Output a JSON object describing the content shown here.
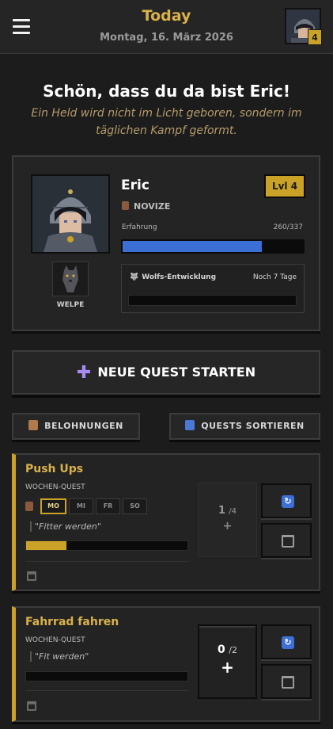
{
  "header": {
    "title": "Today",
    "date": "Montag, 16. März 2026",
    "avatar_level": "4"
  },
  "welcome": {
    "heading": "Schön, dass du da bist Eric!",
    "tagline": "Ein Held wird nicht im Licht geboren, sondern im täglichen Kampf geformt."
  },
  "profile": {
    "name": "Eric",
    "rank": "NOVIZE",
    "level_label": "Lvl 4",
    "xp_label": "Erfahrung",
    "xp_value": "260/337",
    "xp_fraction": 0.772,
    "pet_label": "WELPE",
    "evolution_title": "Wolfs-Entwicklung",
    "evolution_remaining": "Noch 7 Tage",
    "evolution_fraction": 0.0
  },
  "actions": {
    "new_quest": "NEUE QUEST STARTEN",
    "rewards": "BELOHNUNGEN",
    "sort_quests": "QUESTS SORTIEREN"
  },
  "quests": [
    {
      "title": "Push Ups",
      "type": "WOCHEN-QUEST",
      "days": [
        {
          "label": "MO",
          "active": true
        },
        {
          "label": "MI",
          "active": false
        },
        {
          "label": "FR",
          "active": false
        },
        {
          "label": "SO",
          "active": false
        }
      ],
      "motto": "\"Fitter werden\"",
      "progress_fraction": 0.25,
      "count_done": "1",
      "count_total": "/4",
      "count_plus": "+"
    },
    {
      "title": "Fahrrad fahren",
      "type": "WOCHEN-QUEST",
      "motto": "\"Fit werden\"",
      "progress_fraction": 0.0,
      "count_done": "0",
      "count_total": "/2",
      "count_plus": "+"
    }
  ],
  "colors": {
    "accent_gold": "#c9a227",
    "xp_blue": "#3b6fd6",
    "plus_purple": "#a88bf0"
  }
}
